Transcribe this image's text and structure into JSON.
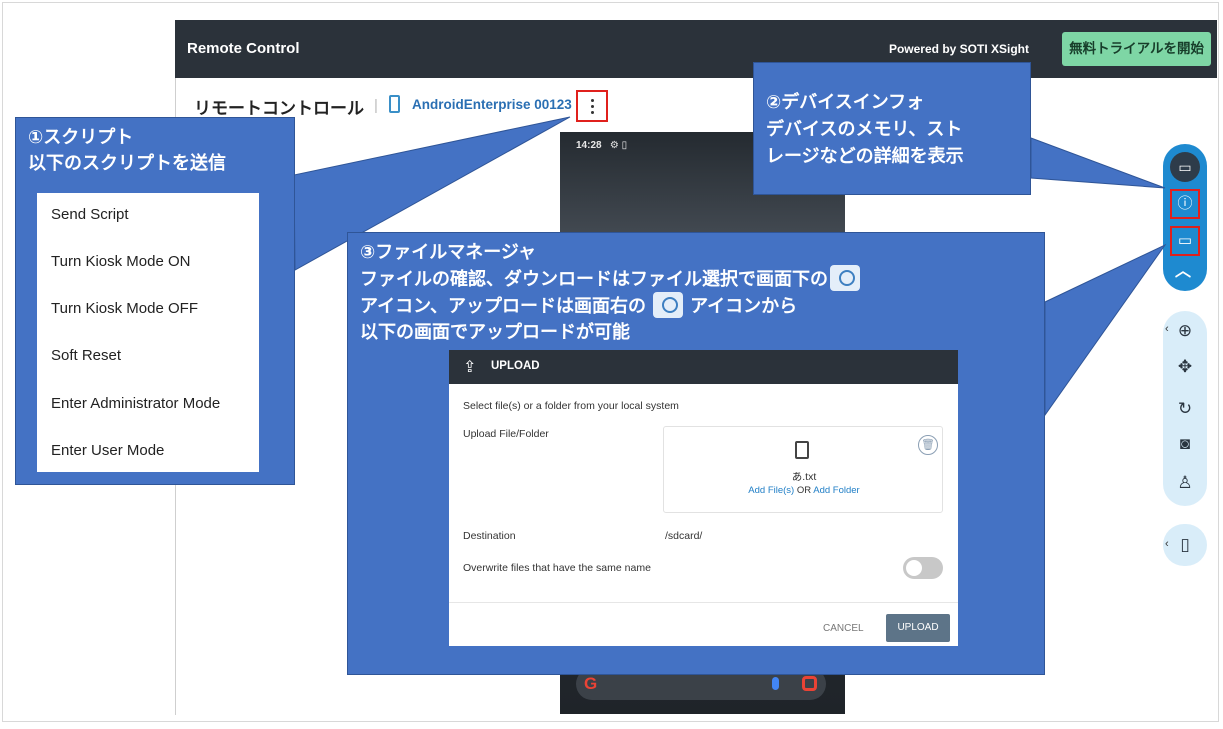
{
  "header": {
    "app_title": "Remote Control",
    "powered_by": "Powered by SOTI XSight",
    "trial_button": "無料トライアルを開始"
  },
  "subheader": {
    "page_title": "リモートコントロール",
    "separator": "|",
    "device_name": "AndroidEnterprise 00123",
    "more_icon": "vertical-dots-icon"
  },
  "phone": {
    "status_time": "14:28",
    "search_logo": "G"
  },
  "toolbar": {
    "icons": [
      "cast-icon",
      "info-icon",
      "folder-icon",
      "chevron-up-icon",
      "zoom-in-icon",
      "move-icon",
      "rotate-icon",
      "camera-icon",
      "user-settings-icon",
      "phone-icon"
    ]
  },
  "callouts": {
    "script": {
      "line1": "①スクリプト",
      "line2": "以下のスクリプトを送信"
    },
    "device_info": {
      "line1": "②デバイスインフォ",
      "line2": "デバイスのメモリ、スト",
      "line3": "レージなどの詳細を表示"
    },
    "file_manager": {
      "line1": "③ファイルマネージャ",
      "line2_pre": "ファイルの確認、ダウンロードはファイル選択で画面下の",
      "line3_pre": "アイコン、アップロードは画面右の",
      "line3_post": "アイコンから",
      "line4": "以下の画面でアップロードが可能"
    }
  },
  "script_menu": {
    "items": [
      "Send Script",
      "Turn Kiosk Mode ON",
      "Turn Kiosk Mode OFF",
      "Soft Reset",
      "Enter Administrator Mode",
      "Enter User Mode"
    ]
  },
  "upload_dialog": {
    "title": "UPLOAD",
    "subtitle": "Select file(s) or a folder from your local system",
    "upload_label": "Upload File/Folder",
    "file_name": "あ.txt",
    "add_files": "Add File(s)",
    "or": "OR",
    "add_folder": "Add Folder",
    "destination_label": "Destination",
    "destination_value": "/sdcard/",
    "overwrite_label": "Overwrite files that have the same name",
    "overwrite_enabled": false,
    "cancel_button": "CANCEL",
    "upload_button": "UPLOAD"
  },
  "colors": {
    "header_bg": "#2b323a",
    "trial_button": "#7ed6a5",
    "callout_bg": "#4472c4",
    "highlight": "#e0201c",
    "toolbar_active": "#1e8ad0",
    "toolbar_bg": "#d9edf9",
    "link": "#1f7ec6"
  }
}
